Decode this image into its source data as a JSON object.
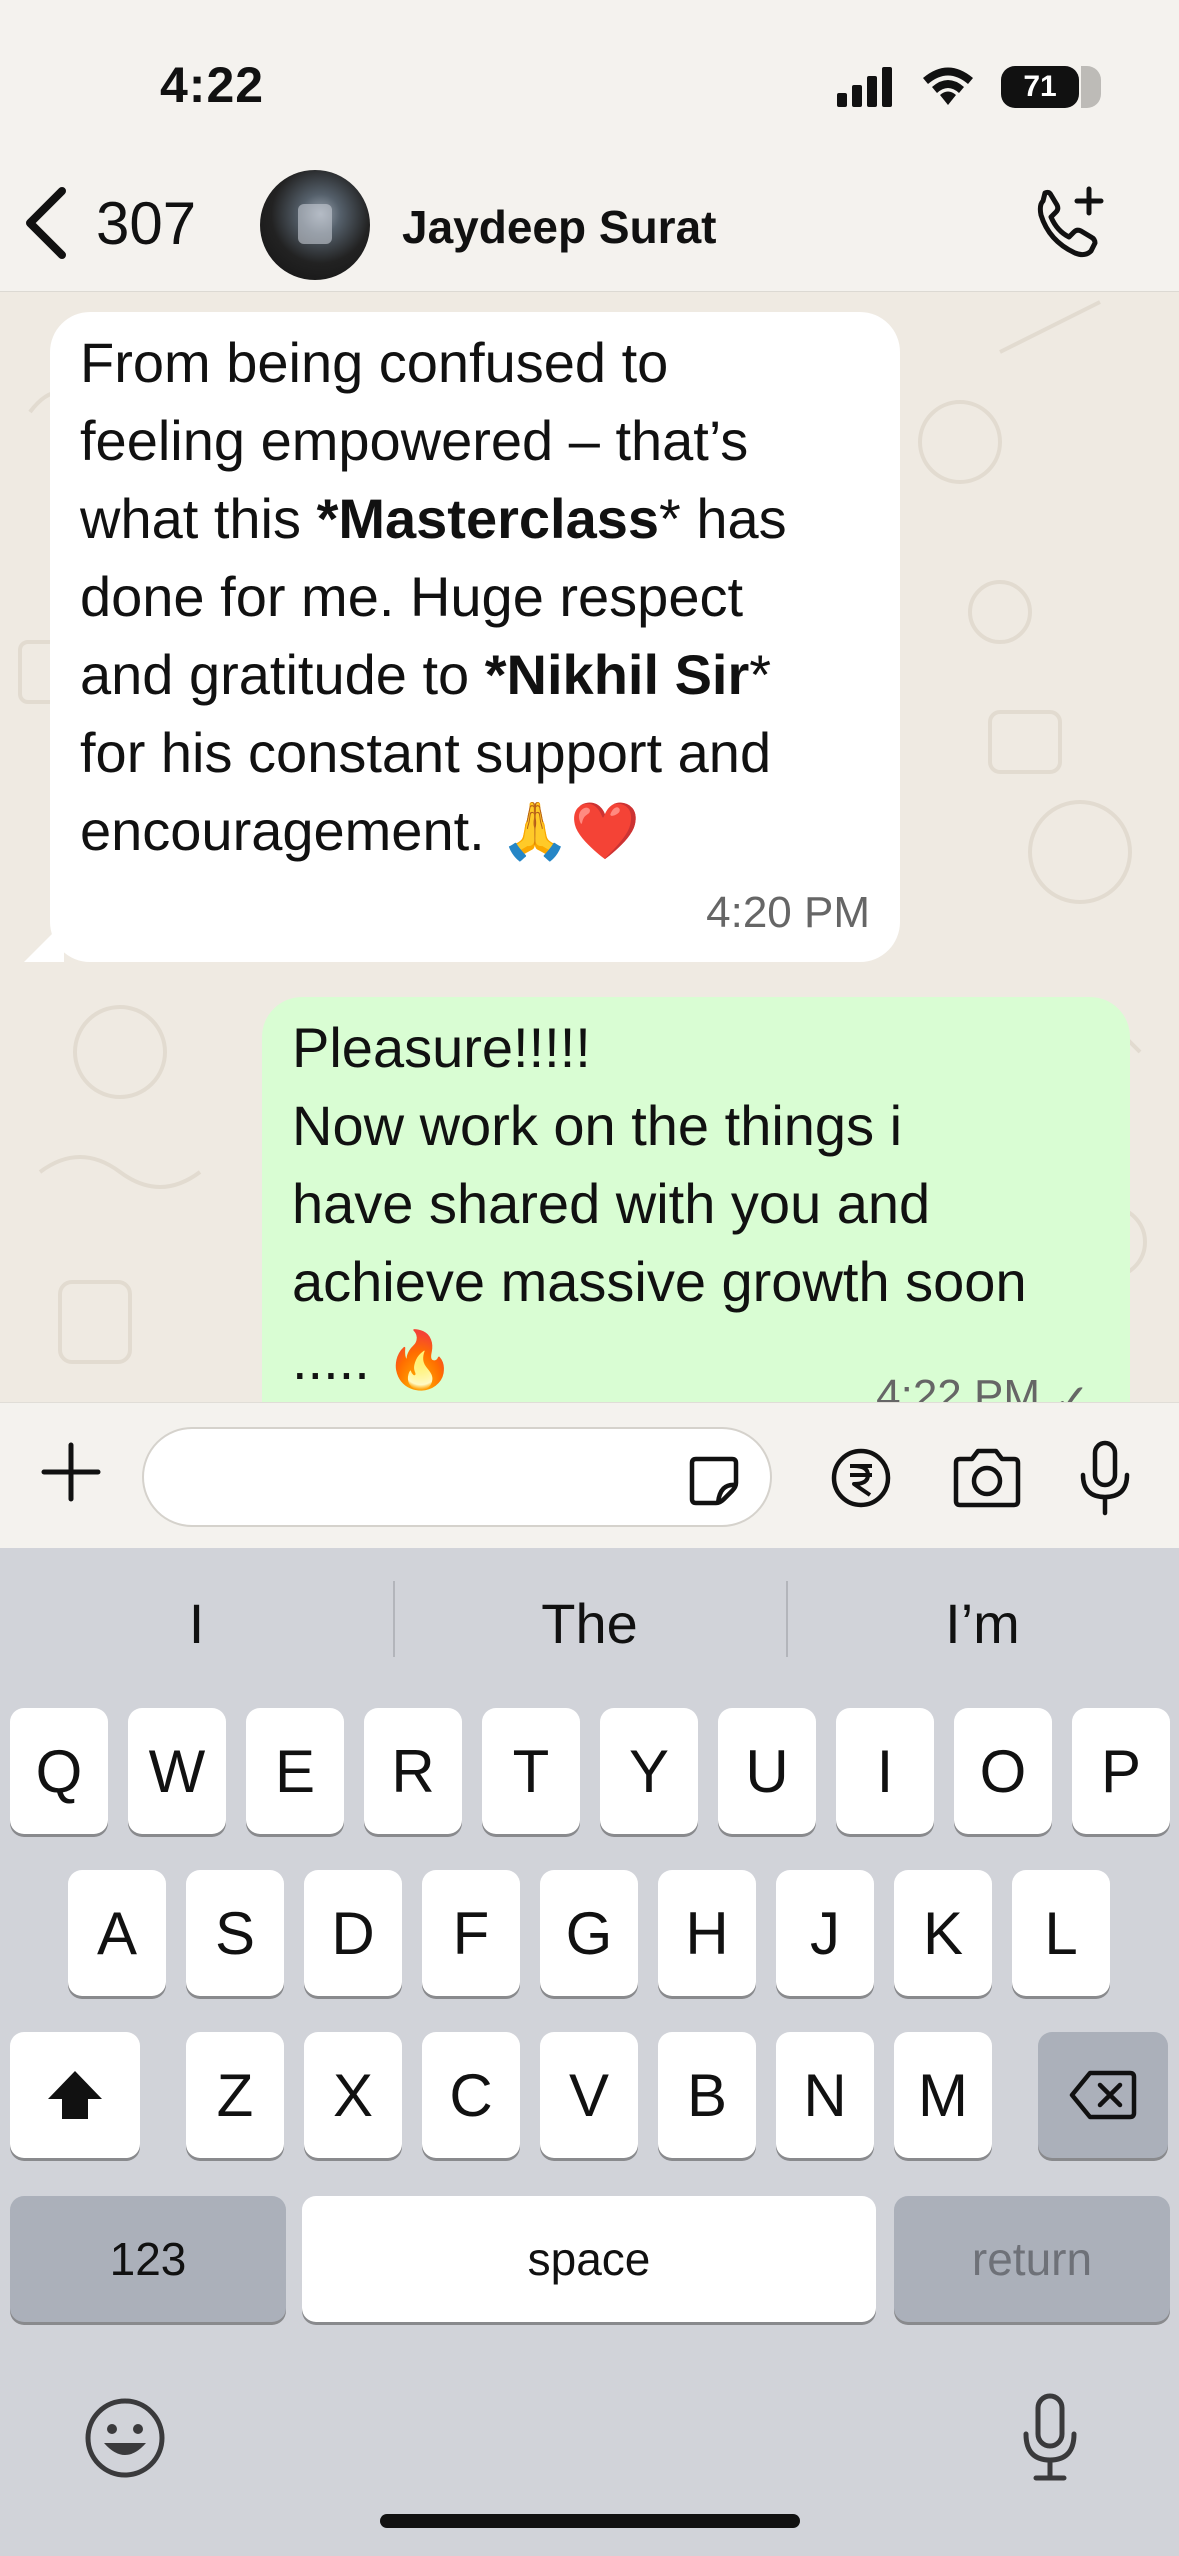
{
  "status_bar": {
    "time": "4:22",
    "battery": "71"
  },
  "header": {
    "back_count": "307",
    "contact_name": "Jaydeep Surat"
  },
  "messages": [
    {
      "direction": "incoming",
      "parts": [
        {
          "text": "From being confused to\nfeeling empowered – that’s\nwhat this ",
          "bold": false
        },
        {
          "text": "*Masterclass",
          "bold": true
        },
        {
          "text": "* has\ndone for me. Huge respect\nand gratitude to ",
          "bold": false
        },
        {
          "text": "*Nikhil Sir",
          "bold": true
        },
        {
          "text": "*\nfor his constant support and\nencouragement. 🙏❤️",
          "bold": false
        }
      ],
      "time": "4:20 PM"
    },
    {
      "direction": "outgoing",
      "text": "Pleasure!!!!!\nNow work on the things i\nhave shared with you and\nachieve massive growth soon\n..... 🔥",
      "time": "4:22 PM",
      "status": "✓"
    }
  ],
  "input": {
    "placeholder": ""
  },
  "keyboard": {
    "suggestions": [
      "I",
      "The",
      "I’m"
    ],
    "row1": [
      "Q",
      "W",
      "E",
      "R",
      "T",
      "Y",
      "U",
      "I",
      "O",
      "P"
    ],
    "row2": [
      "A",
      "S",
      "D",
      "F",
      "G",
      "H",
      "J",
      "K",
      "L"
    ],
    "row3": [
      "Z",
      "X",
      "C",
      "V",
      "B",
      "N",
      "M"
    ],
    "numbers_label": "123",
    "space_label": "space",
    "return_label": "return"
  },
  "colors": {
    "incoming_bubble": "#ffffff",
    "outgoing_bubble": "#d9fdd3",
    "chat_bg": "#efeae2",
    "keyboard_bg": "#d1d3d9"
  }
}
